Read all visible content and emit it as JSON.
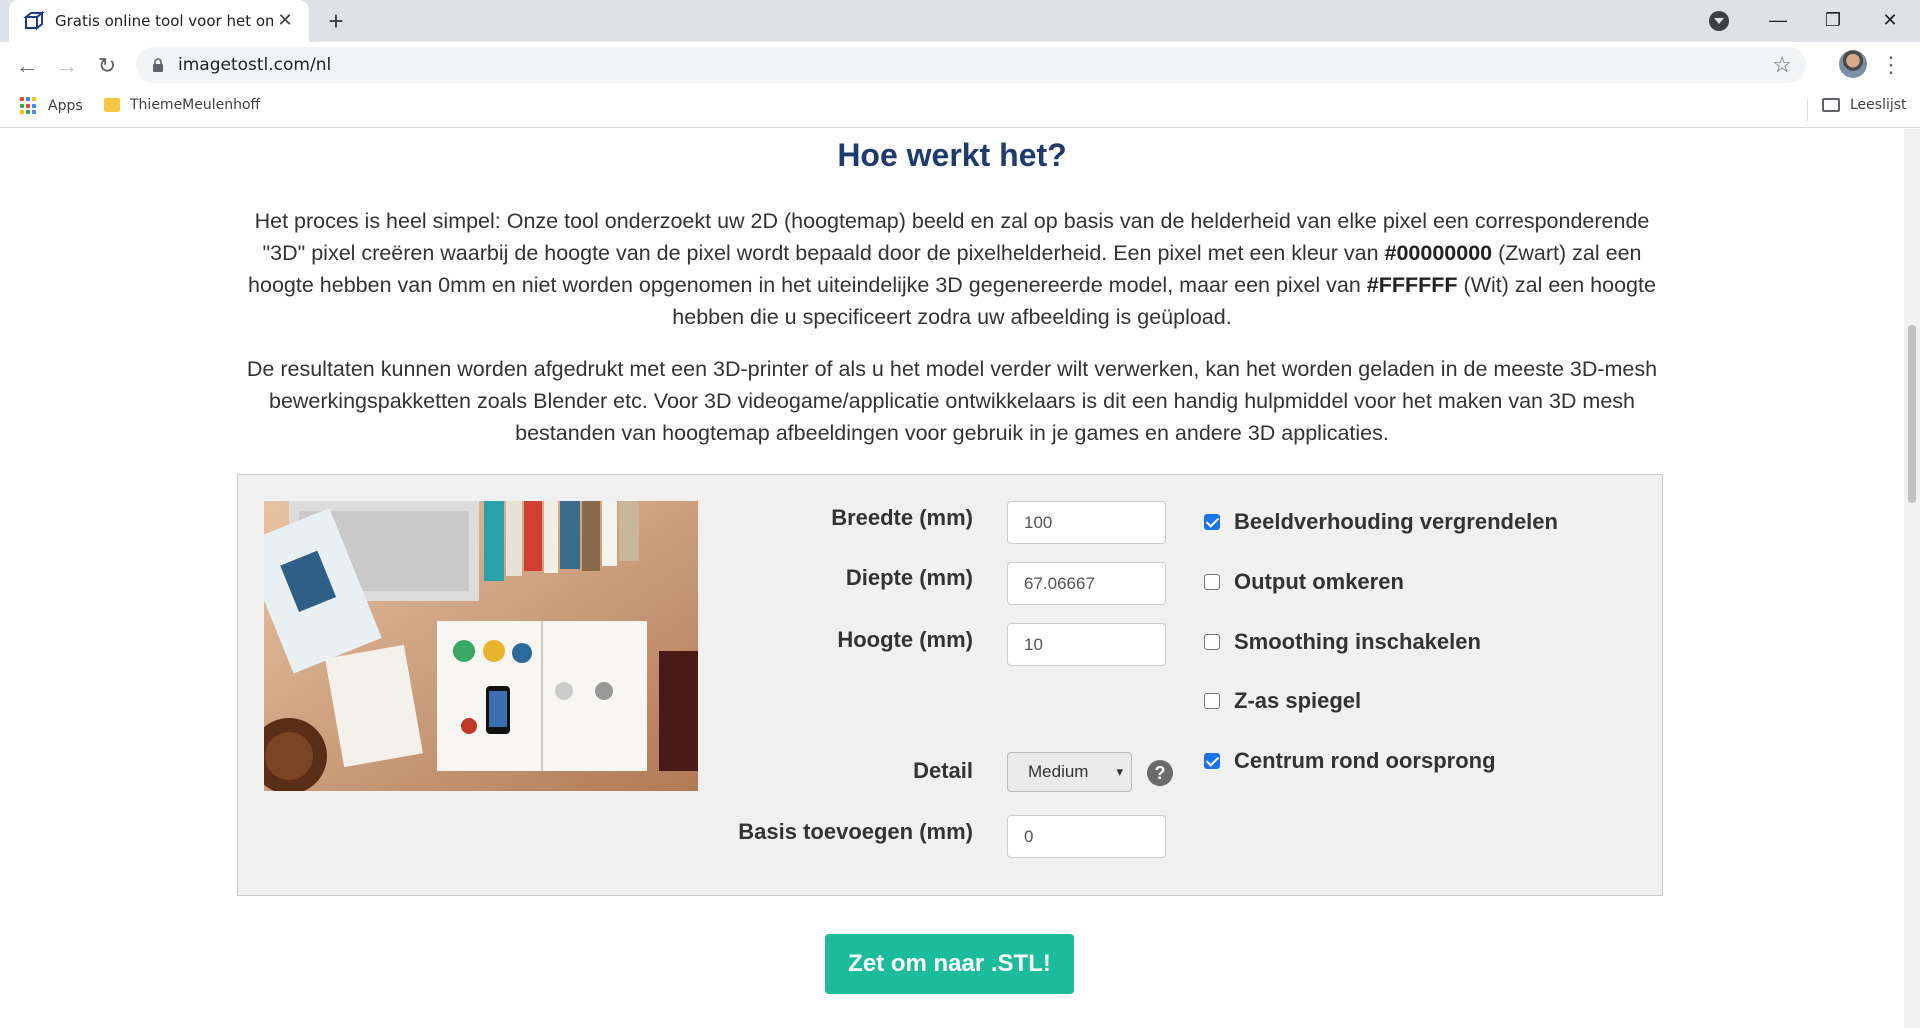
{
  "browser": {
    "tab_title": "Gratis online tool voor het omzetten",
    "url": "imagetostl.com/nl",
    "bookmarks": [
      {
        "label": "Apps"
      },
      {
        "label": "ThiemeMeulenhoff"
      }
    ],
    "reading_list_label": "Leeslijst"
  },
  "page": {
    "heading": "Hoe werkt het?",
    "para1_pre": "Het proces is heel simpel: Onze tool onderzoekt uw 2D (hoogtemap) beeld en zal op basis van de helderheid van elke pixel een corresponderende \"3D\" pixel creëren waarbij de hoogte van de pixel wordt bepaald door de pixelhelderheid. Een pixel met een kleur van ",
    "para1_black_code": "#00000000",
    "para1_mid": " (Zwart) zal een hoogte hebben van 0mm en niet worden opgenomen in het uiteindelijke 3D gegenereerde model, maar een pixel van ",
    "para1_white_code": "#FFFFFF",
    "para1_post": " (Wit) zal een hoogte hebben die u specificeert zodra uw afbeelding is geüpload.",
    "para2": "De resultaten kunnen worden afgedrukt met een 3D-printer of als u het model verder wilt verwerken, kan het worden geladen in de meeste 3D-mesh bewerkingspakketten zoals Blender etc. Voor 3D videogame/applicatie ontwikkelaars is dit een handig hulpmiddel voor het maken van 3D mesh bestanden van hoogtemap afbeeldingen voor gebruik in je games en andere 3D applicaties."
  },
  "form": {
    "width_label": "Breedte (mm)",
    "width_value": "100",
    "depth_label": "Diepte (mm)",
    "depth_value": "67.06667",
    "height_label": "Hoogte (mm)",
    "height_value": "10",
    "detail_label": "Detail",
    "detail_value": "Medium",
    "base_label": "Basis toevoegen (mm)",
    "base_value": "0",
    "help_symbol": "?",
    "checkboxes": [
      {
        "label": "Beeldverhouding vergrendelen",
        "checked": true
      },
      {
        "label": "Output omkeren",
        "checked": false
      },
      {
        "label": "Smoothing inschakelen",
        "checked": false
      },
      {
        "label": "Z-as spiegel",
        "checked": false
      },
      {
        "label": "Centrum rond oorsprong",
        "checked": true
      }
    ],
    "convert_label": "Zet om naar .STL!"
  },
  "colors": {
    "heading": "#1f3a6d",
    "convert_button": "#1abc9c",
    "checkbox_checked": "#1a73e8"
  }
}
